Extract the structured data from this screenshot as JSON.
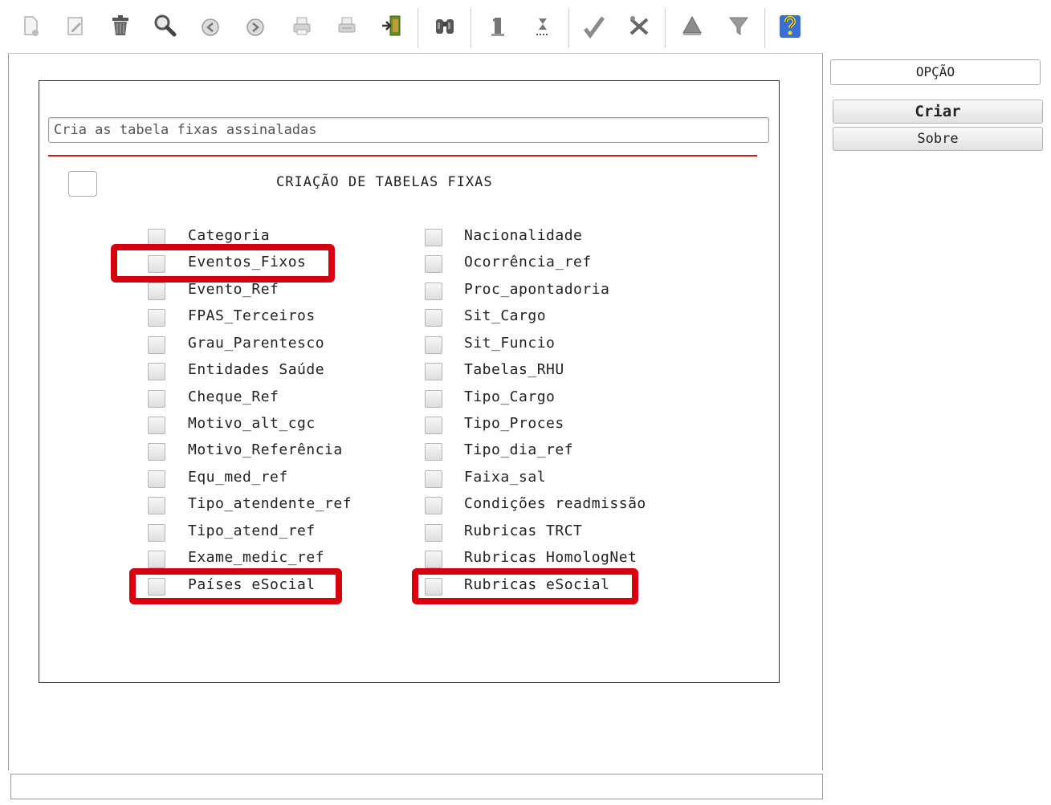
{
  "toolbar": {
    "buttons": [
      "new-doc-icon",
      "edit-icon",
      "trash-icon",
      "search-icon",
      "previous-icon",
      "next-icon",
      "print-icon",
      "print-preview-icon",
      "exit-icon",
      "binoculars-icon",
      "first-icon",
      "last-icon",
      "confirm-icon",
      "tools-icon",
      "up-icon",
      "filter-icon",
      "help-icon"
    ]
  },
  "dialog": {
    "description": "Cria as tabela fixas assinaladas",
    "title": "CRIAÇÃO DE TABELAS FIXAS",
    "left_items": [
      "Categoria",
      "Eventos_Fixos",
      "Evento_Ref",
      "FPAS_Terceiros",
      "Grau_Parentesco",
      "Entidades Saúde",
      "Cheque_Ref",
      "Motivo_alt_cgc",
      "Motivo_Referência",
      "Equ_med_ref",
      "Tipo_atendente_ref",
      "Tipo_atend_ref",
      "Exame_medic_ref",
      "Países eSocial"
    ],
    "right_items": [
      "Nacionalidade",
      "Ocorrência_ref",
      "Proc_apontadoria",
      "Sit_Cargo",
      "Sit_Funcio",
      "Tabelas_RHU",
      "Tipo_Cargo",
      "Tipo_Proces",
      "Tipo_dia_ref",
      "Faixa_sal",
      "Condições readmissão",
      "Rubricas TRCT",
      "Rubricas HomologNet",
      "Rubricas eSocial"
    ]
  },
  "side": {
    "option_label": "OPÇÃO",
    "create_label": "Criar",
    "about_label": "Sobre"
  },
  "colors": {
    "highlight": "#d5000f",
    "divider": "#d21a1a"
  }
}
